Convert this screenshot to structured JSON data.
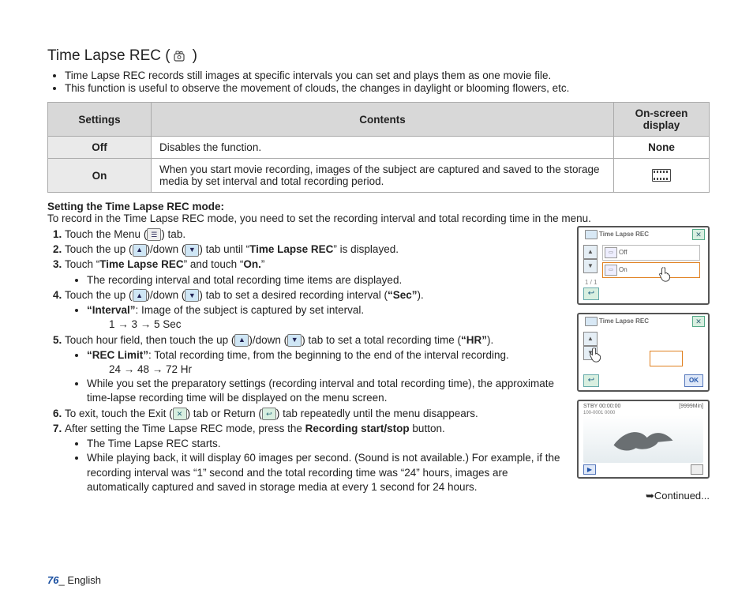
{
  "title": "Time Lapse REC (",
  "title_close": ")",
  "intro": [
    "Time Lapse REC records still images at specific intervals you can set and plays them as one movie file.",
    "This function is useful to observe the movement of clouds, the changes in daylight or blooming flowers, etc."
  ],
  "table": {
    "headers": {
      "settings": "Settings",
      "contents": "Contents",
      "display": "On-screen display"
    },
    "rows": [
      {
        "setting": "Off",
        "content": "Disables the function.",
        "display": "None"
      },
      {
        "setting": "On",
        "content": "When you start movie recording, images of the subject are captured and saved to the storage media by set interval and total recording period.",
        "display_icon": "film"
      }
    ]
  },
  "setting_mode_head": "Setting the Time Lapse REC mode:",
  "setting_mode_intro": "To record in the Time Lapse REC mode, you need to set the recording interval and total recording time in the menu.",
  "steps": {
    "s1a": "Touch the Menu (",
    "s1b": ") tab.",
    "s2a": "Touch the up (",
    "s2b": ")/down (",
    "s2c": ") tab until “",
    "s2d": "Time Lapse REC",
    "s2e": "” is displayed.",
    "s3a": "Touch “",
    "s3b": "Time Lapse REC",
    "s3c": "” and touch “",
    "s3d": "On.",
    "s3e": "”",
    "s3_sub": "The recording interval and total recording time items are displayed.",
    "s4a": "Touch the up (",
    "s4b": ")/down (",
    "s4c": ") tab to set a desired recording interval (",
    "s4d": "“Sec”",
    "s4e": ").",
    "s4_sub_lbl": "“Interval”",
    "s4_sub_txt": ": Image of the subject is captured by set interval.",
    "s4_seq": "1 → 3 → 5 Sec",
    "s5a": "Touch hour field, then touch the up (",
    "s5b": ")/down (",
    "s5c": ") tab to set a total recording time (",
    "s5d": "“HR”",
    "s5e": ").",
    "s5_sub_lbl": "“REC Limit”",
    "s5_sub_txt": ": Total recording time, from the beginning to the end of the interval recording.",
    "s5_seq": "24 → 48 → 72 Hr",
    "s5_note": "While you set the preparatory settings (recording interval and total recording time), the approximate time-lapse recording time will be displayed on the menu screen.",
    "s6a": "To exit, touch the Exit (",
    "s6b": ") tab or Return (",
    "s6c": ") tab repeatedly until the menu disappears.",
    "s7a": "After setting the Time Lapse REC mode, press the ",
    "s7b": "Recording start/stop",
    "s7c": " button.",
    "s7_sub1": "The Time Lapse REC starts.",
    "s7_sub2": "While playing back, it will display 60 images per second. (Sound is not available.) For example, if the recording interval was “1” second and the total recording time was “24” hours, images are automatically captured and saved in storage media at every 1 second for 24 hours."
  },
  "screens": {
    "title": "Time Lapse REC",
    "off": "Off",
    "on": "On",
    "pager": "1 / 1",
    "ok": "OK",
    "stby": "STBY  00:00:00",
    "min": "[9999Min]",
    "info": "   100-0001   0000"
  },
  "continued": "➥Continued...",
  "footer": {
    "page": "76",
    "sep": "_ ",
    "lang": "English"
  }
}
